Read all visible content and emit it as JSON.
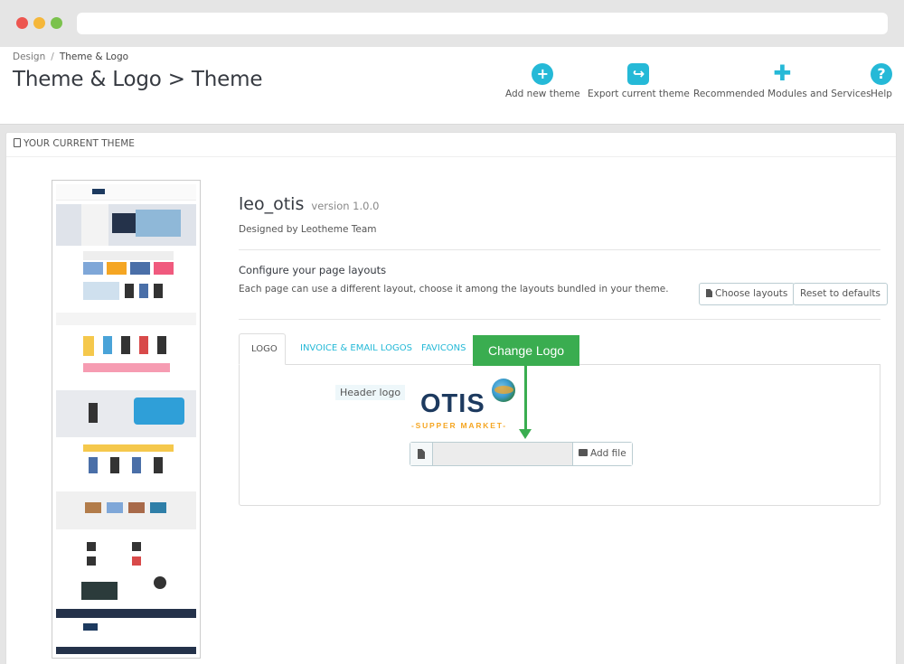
{
  "breadcrumb": {
    "parent": "Design",
    "current": "Theme & Logo"
  },
  "page_title": "Theme & Logo > Theme",
  "toolbar": [
    {
      "label": "Add new theme",
      "icon": "plus-circle-icon"
    },
    {
      "label": "Export current theme",
      "icon": "share-icon"
    },
    {
      "label": "Recommended Modules and Services",
      "icon": "puzzle-icon"
    },
    {
      "label": "Help",
      "icon": "help-icon"
    }
  ],
  "panel": {
    "heading": "YOUR CURRENT THEME"
  },
  "theme": {
    "name": "leo_otis",
    "version": "version 1.0.0",
    "author": "Designed by Leotheme Team"
  },
  "layouts": {
    "title": "Configure your page layouts",
    "description": "Each page can use a different layout, choose it among the layouts bundled in your theme.",
    "choose_label": "Choose layouts",
    "reset_label": "Reset to defaults"
  },
  "tabs": [
    "LOGO",
    "INVOICE & EMAIL LOGOS",
    "FAVICONS"
  ],
  "logo_section": {
    "label": "Header logo",
    "logo_text": "OTIS",
    "logo_subtext": "-SUPPER MARKET-",
    "add_file_label": "Add file"
  },
  "annotation": {
    "text": "Change Logo",
    "color": "#3aad50"
  },
  "colors": {
    "accent": "#25b9d7",
    "title": "#363a41",
    "logo_navy": "#1d3a5f",
    "logo_orange": "#f5a623"
  }
}
